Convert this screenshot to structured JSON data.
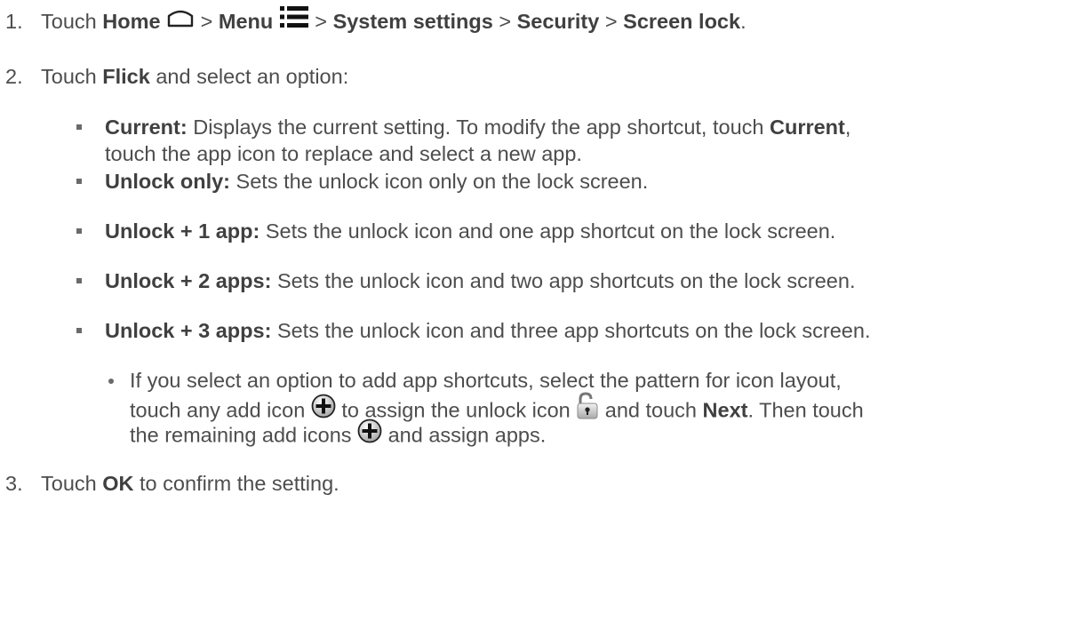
{
  "steps": [
    {
      "number": "1.",
      "touch": "Touch",
      "home": "Home",
      "sep1": ">",
      "menu": "Menu",
      "sep2": ">",
      "system_settings": "System settings",
      "sep3": ">",
      "security": "Security",
      "sep4": ">",
      "screen_lock": "Screen lock",
      "period": "."
    },
    {
      "number": "2.",
      "touch": "Touch",
      "flick": "Flick",
      "rest": "and select an option:"
    },
    {
      "number": "3.",
      "touch": "Touch",
      "ok": "OK",
      "rest": "to confirm the setting."
    }
  ],
  "options": [
    {
      "term": "Current:",
      "text_a": "Displays the current setting. To modify the app shortcut, touch",
      "term2": "Current",
      "comma": ",",
      "text_b": "touch the app icon to replace and select a new app."
    },
    {
      "term": "Unlock only:",
      "text": "Sets the unlock icon only on the lock screen."
    },
    {
      "term": "Unlock + 1 app:",
      "text": "Sets the unlock icon and one app shortcut on the lock screen."
    },
    {
      "term": "Unlock + 2 apps:",
      "text": "Sets the unlock icon and two app shortcuts on the lock screen."
    },
    {
      "term": "Unlock + 3 apps:",
      "text": "Sets the unlock icon and three app shortcuts on the lock screen."
    }
  ],
  "note": {
    "line1": "If you select an option to add app shortcuts, select the pattern for icon layout,",
    "line2_a": "touch any add icon",
    "line2_b": "to assign the unlock icon",
    "line2_c": "and touch",
    "next": "Next",
    "line2_d": ". Then touch",
    "line3_a": "the remaining add icons",
    "line3_b": "and assign apps."
  },
  "icons": {
    "home": "home-icon",
    "menu": "menu-icon",
    "add": "add-icon",
    "unlock": "unlock-icon"
  }
}
